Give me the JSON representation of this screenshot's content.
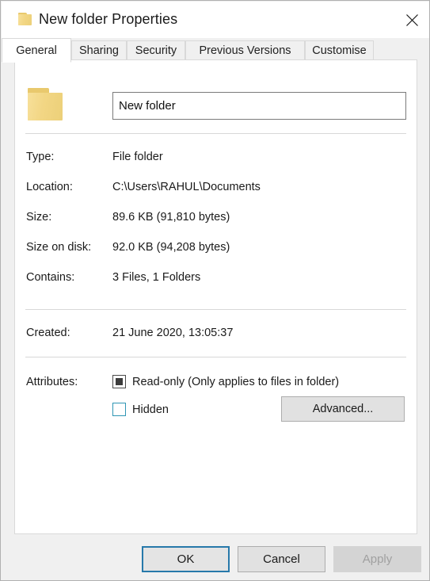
{
  "window": {
    "title": "New folder Properties",
    "icon": "folder-icon",
    "close_label": "✕"
  },
  "tabs": [
    {
      "label": "General",
      "active": true
    },
    {
      "label": "Sharing",
      "active": false
    },
    {
      "label": "Security",
      "active": false
    },
    {
      "label": "Previous Versions",
      "active": false
    },
    {
      "label": "Customise",
      "active": false
    }
  ],
  "general": {
    "folder_icon": "folder-icon",
    "name_value": "New folder",
    "name_placeholder": "",
    "rows": [
      {
        "label": "Type:",
        "value": "File folder"
      },
      {
        "label": "Location:",
        "value": "C:\\Users\\RAHUL\\Documents"
      },
      {
        "label": "Size:",
        "value": "89.6 KB (91,810 bytes)"
      },
      {
        "label": "Size on disk:",
        "value": "92.0 KB (94,208 bytes)"
      },
      {
        "label": "Contains:",
        "value": "3 Files, 1 Folders"
      }
    ],
    "created": {
      "label": "Created:",
      "value": "21 June 2020, 13:05:37"
    },
    "attributes": {
      "label": "Attributes:",
      "readonly": {
        "label": "Read-only (Only applies to files in folder)",
        "state": "indeterminate"
      },
      "hidden": {
        "label": "Hidden",
        "state": "unchecked"
      },
      "advanced_label": "Advanced..."
    }
  },
  "footer": {
    "ok_label": "OK",
    "cancel_label": "Cancel",
    "apply_label": "Apply",
    "apply_disabled": true
  },
  "colors": {
    "accent": "#2779aa",
    "checkbox_accent": "#2f96b4",
    "folder_yellow": "#f3d989",
    "dialog_bg": "#f0f0f0",
    "panel_bg": "#ffffff"
  }
}
